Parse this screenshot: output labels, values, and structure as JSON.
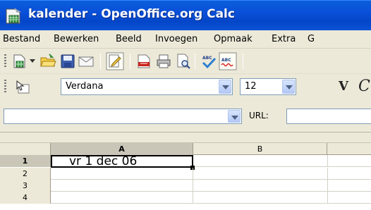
{
  "window": {
    "title": "kalender - OpenOffice.org Calc"
  },
  "menubar": {
    "items": [
      {
        "label": "Bestand"
      },
      {
        "label": "Bewerken"
      },
      {
        "label": "Beeld"
      },
      {
        "label": "Invoegen"
      },
      {
        "label": "Opmaak"
      },
      {
        "label": "Extra"
      },
      {
        "label": "G"
      }
    ]
  },
  "toolbar": {
    "icons": [
      "new-document-icon",
      "open-folder-icon",
      "save-icon",
      "email-icon",
      "edit-file-icon",
      "export-pdf-icon",
      "print-icon",
      "page-preview-icon",
      "spellcheck-icon",
      "autospellcheck-icon"
    ]
  },
  "formatting": {
    "font_name": "Verdana",
    "font_size": "12",
    "style_v": "V",
    "style_c": "C"
  },
  "formula_bar": {
    "namebox_value": "",
    "url_label": "URL:",
    "url_value": ""
  },
  "sheet": {
    "columns": [
      "A",
      "B"
    ],
    "selected_column": "A",
    "rows": [
      "1",
      "2",
      "3",
      "4"
    ],
    "selected_row": "1",
    "cells": {
      "A1": "vr 1 dec 06"
    }
  },
  "colors": {
    "titlebar": "#0a4fd8",
    "chrome": "#ece9d8",
    "header_selected": "#c9c6b8"
  }
}
